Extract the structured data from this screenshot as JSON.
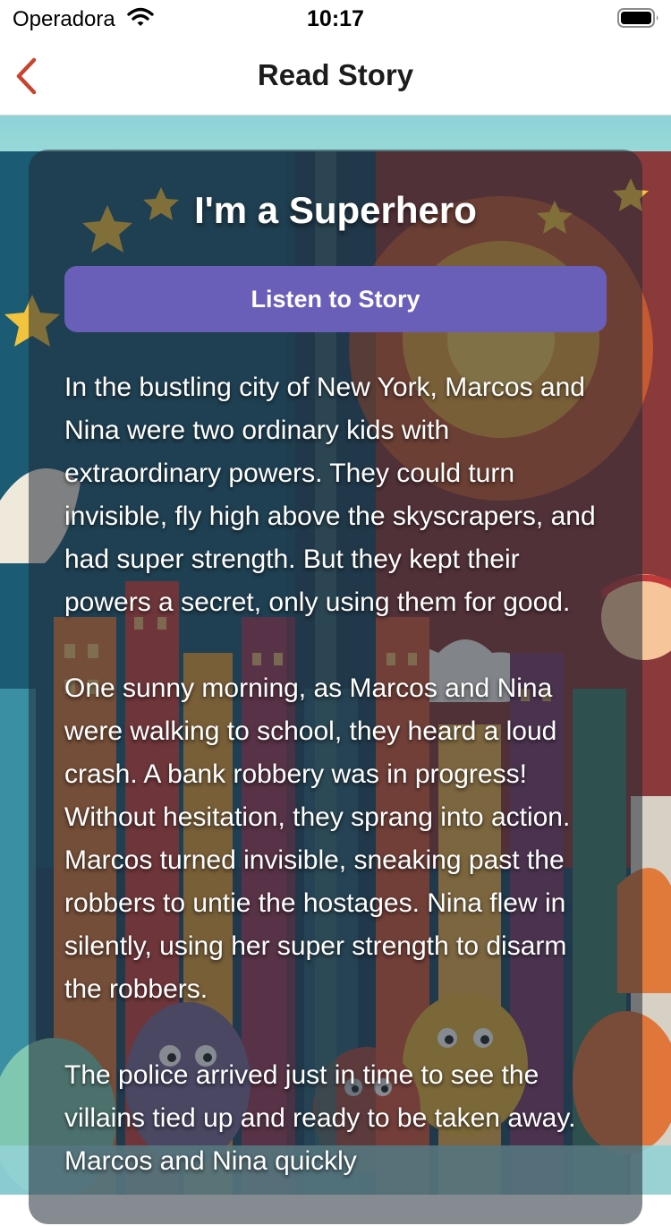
{
  "status_bar": {
    "carrier": "Operadora",
    "time": "10:17",
    "icons": [
      "wifi-icon",
      "battery-icon"
    ]
  },
  "nav": {
    "back_icon": "chevron-left-icon",
    "title": "Read Story",
    "accent_color": "#c8442c"
  },
  "story": {
    "title": "I'm a Superhero",
    "listen_label": "Listen to Story",
    "button_color": "#6a5fb8",
    "paragraphs": [
      "In the bustling city of New York, Marcos and Nina were two ordinary kids with extraordinary powers. They could turn invisible, fly high above the skyscrapers, and had super strength. But they kept their powers a secret, only using them for good.",
      "One sunny morning, as Marcos and Nina were walking to school, they heard a loud crash. A bank robbery was in progress! Without hesitation, they sprang into action. Marcos turned invisible, sneaking past the robbers to untie the hostages. Nina flew in silently, using her super strength to disarm the robbers.",
      "The police arrived just in time to see the villains tied up and ready to be taken away. Marcos and Nina quickly"
    ]
  }
}
